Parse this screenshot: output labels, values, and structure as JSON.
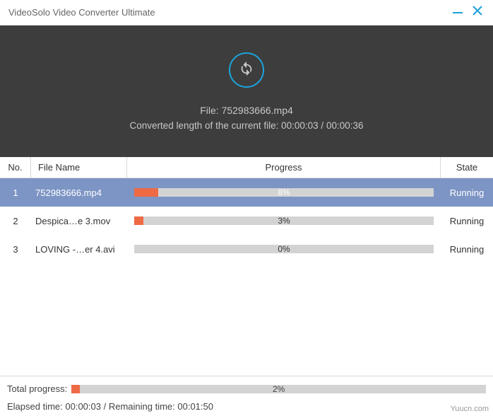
{
  "window": {
    "title": "VideoSolo Video Converter Ultimate"
  },
  "hero": {
    "file_prefix": "File: ",
    "file_name": "752983666.mp4",
    "length_prefix": "Converted length of the current file: ",
    "elapsed": "00:00:03",
    "sep": " / ",
    "total": "00:00:36"
  },
  "columns": {
    "no": "No.",
    "name": "File Name",
    "progress": "Progress",
    "state": "State"
  },
  "rows": [
    {
      "no": "1",
      "name": "752983666.mp4",
      "pct": 8,
      "pct_label": "8%",
      "state": "Running",
      "selected": true
    },
    {
      "no": "2",
      "name": "Despica…e 3.mov",
      "pct": 3,
      "pct_label": "3%",
      "state": "Running",
      "selected": false
    },
    {
      "no": "3",
      "name": "LOVING -…er 4.avi",
      "pct": 0,
      "pct_label": "0%",
      "state": "Running",
      "selected": false
    }
  ],
  "footer": {
    "total_label": "Total progress:",
    "total_pct": 2,
    "total_pct_label": "2%",
    "time_line_prefix": "Elapsed time: ",
    "elapsed": "00:00:03",
    "sep": " / ",
    "remaining_prefix": "Remaining time: ",
    "remaining": "00:01:50"
  },
  "watermark": "Yuucn.com"
}
